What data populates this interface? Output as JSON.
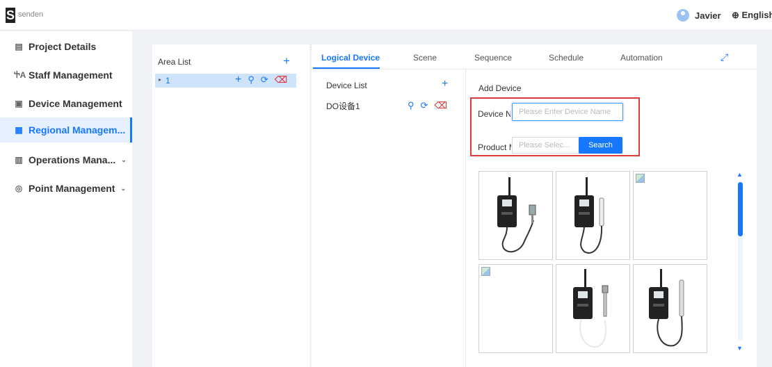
{
  "header": {
    "logo_letter": "S",
    "logo_text": "senden",
    "user_name": "Javier",
    "language": "⊕ English"
  },
  "sidebar": {
    "items": [
      {
        "label": "Project Details",
        "icon": "document-icon",
        "glyph": "▤"
      },
      {
        "label": "Staff Management",
        "icon": "person-icon",
        "glyph": "ႵA"
      },
      {
        "label": "Device Management",
        "icon": "device-icon",
        "glyph": "▣"
      },
      {
        "label": "Regional Managem...",
        "icon": "grid-icon",
        "glyph": "▦",
        "active": true
      },
      {
        "label": "Operations Mana...",
        "icon": "chart-icon",
        "glyph": "▥",
        "chevron": "⌄"
      },
      {
        "label": "Point Management",
        "icon": "location-icon",
        "glyph": "◎",
        "chevron": "⌄"
      }
    ]
  },
  "area": {
    "title": "Area List",
    "add": "+",
    "row_value": "1",
    "caret": "▸"
  },
  "tabs": [
    "Logical Device",
    "Scene",
    "Sequence",
    "Schedule",
    "Automation"
  ],
  "expand_glyph": "⤢",
  "device_list": {
    "title": "Device List",
    "add": "+",
    "item": "DO设备1"
  },
  "add_device": {
    "title": "Add Device",
    "name_label": "Device Name",
    "name_placeholder": "Please Enter Device Name",
    "product_label": "Product Model",
    "product_placeholder": "Please Selec...",
    "search": "Search"
  },
  "icons": {
    "add": "+",
    "link": "🔗",
    "refresh": "⟳",
    "delete": "🗑",
    "scroll_up": "▲",
    "scroll_down": "▼"
  },
  "colors": {
    "accent": "#1677ff",
    "danger": "#e02020",
    "highlight_box": "#e03a3a"
  }
}
